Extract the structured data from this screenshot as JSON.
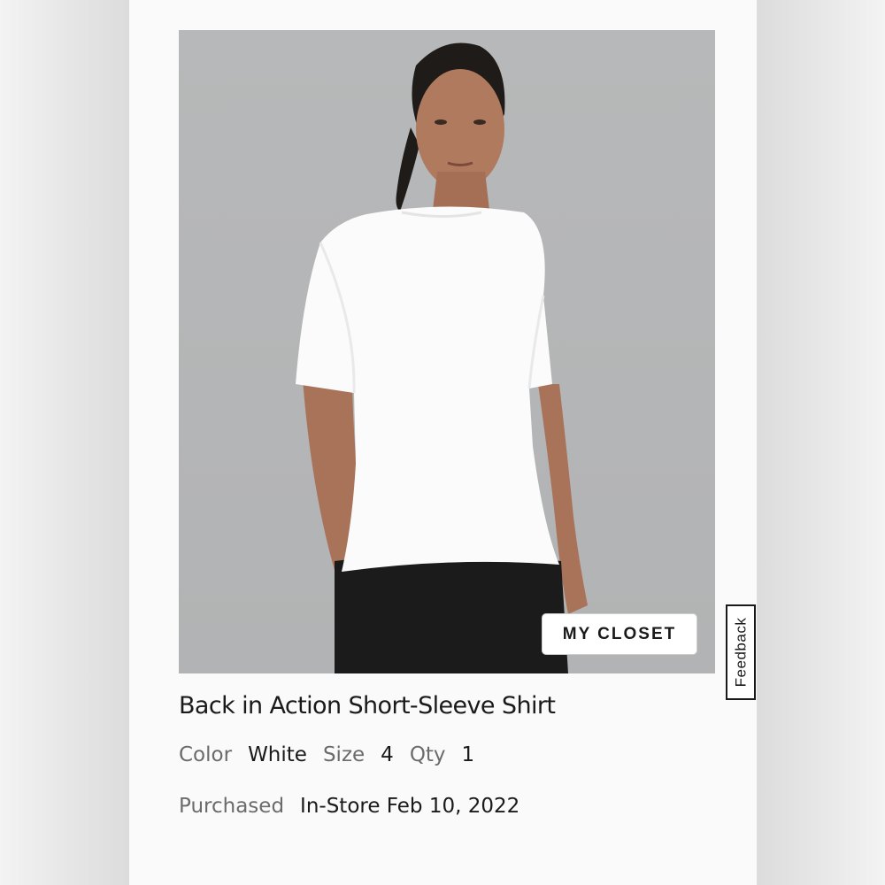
{
  "product": {
    "name": "Back in Action Short-Sleeve Shirt",
    "color_label": "Color",
    "color_value": "White",
    "size_label": "Size",
    "size_value": "4",
    "qty_label": "Qty",
    "qty_value": "1",
    "purchased_label": "Purchased",
    "purchased_value": "In-Store Feb 10, 2022"
  },
  "closet_button": {
    "label": "MY CLOSET"
  },
  "feedback_tab": {
    "label": "Feedback"
  },
  "colors": {
    "card_bg": "#fafafa",
    "photo_bg": "#b7b8b9",
    "text_primary": "#1a1a1a",
    "text_secondary": "#6b6b6b"
  }
}
